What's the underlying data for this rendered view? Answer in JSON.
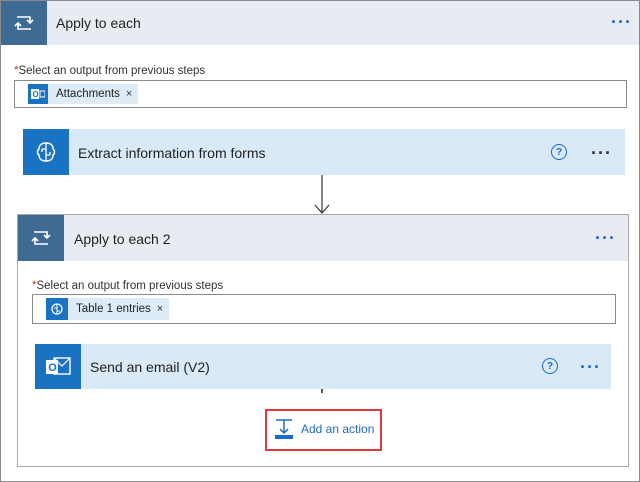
{
  "outer_loop": {
    "title": "Apply to each",
    "select_label": "Select an output from previous steps",
    "required_mark": "*",
    "token_label": "Attachments",
    "remove_glyph": "×",
    "more_glyph": "···"
  },
  "extract_action": {
    "title": "Extract information from forms",
    "help_glyph": "?",
    "more_glyph": "···"
  },
  "inner_loop": {
    "title": "Apply to each 2",
    "select_label": "Select an output from previous steps",
    "required_mark": "*",
    "token_label": "Table 1 entries",
    "remove_glyph": "×",
    "more_glyph": "···"
  },
  "email_action": {
    "title": "Send an email (V2)",
    "help_glyph": "?",
    "more_glyph": "···"
  },
  "add_action": {
    "label": "Add an action"
  },
  "colors": {
    "loop_header": "#3f6a93",
    "action_card": "#d9e9f6",
    "accent": "#1b6ac9",
    "highlight_box": "#e0393e"
  },
  "icons": [
    "loop-icon",
    "outlook-icon",
    "ai-brain-icon",
    "ai-builder-icon",
    "outlook-mail-icon",
    "add-action-icon",
    "help-icon",
    "more-icon",
    "remove-icon",
    "down-arrow-icon"
  ]
}
